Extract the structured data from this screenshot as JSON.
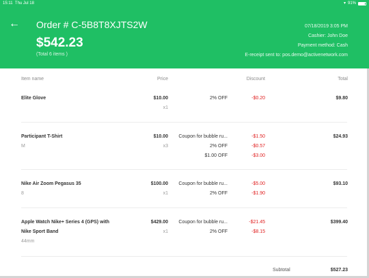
{
  "status_bar": {
    "time": "15:11",
    "date": "Thu Jul 18",
    "battery": "91%",
    "wifi_icon": "wifi-icon",
    "battery_level": 0.91
  },
  "header": {
    "order_title": "Order # C-5B8T8XJTS2W",
    "order_total": "$542.23",
    "item_count": "(Total 6 items )",
    "datetime": "07/18/2019 3:05 PM",
    "cashier": "Cashier: John Doe",
    "payment_method": "Payment method: Cash",
    "ereceipt": "E-receipt sent to: pos.demo@activenetwork.com",
    "back_icon": "arrow-left-icon"
  },
  "columns": {
    "item_name": "Item name",
    "price": "Price",
    "discount": "Discount",
    "total": "Total"
  },
  "items": [
    {
      "name": "Elite Glove",
      "variant": "",
      "price": "$10.00",
      "qty": "x1",
      "discounts": [
        {
          "desc": "2% OFF",
          "amount": "-$0.20"
        }
      ],
      "total": "$9.80"
    },
    {
      "name": "Participant T-Shirt",
      "variant": "M",
      "price": "$10.00",
      "qty": "x3",
      "discounts": [
        {
          "desc": "Coupon for bubble ru...",
          "amount": "-$1.50"
        },
        {
          "desc": "2% OFF",
          "amount": "-$0.57"
        },
        {
          "desc": "$1.00 OFF",
          "amount": "-$3.00"
        }
      ],
      "total": "$24.93"
    },
    {
      "name": "Nike Air Zoom Pegasus 35",
      "variant": "8",
      "price": "$100.00",
      "qty": "x1",
      "discounts": [
        {
          "desc": "Coupon for bubble ru...",
          "amount": "-$5.00"
        },
        {
          "desc": "2% OFF",
          "amount": "-$1.90"
        }
      ],
      "total": "$93.10"
    },
    {
      "name_line1": "Apple Watch Nike+ Series 4 (GPS) with",
      "name_line2": "Nike Sport Band",
      "variant": "44mm",
      "price": "$429.00",
      "qty": "x1",
      "discounts": [
        {
          "desc": "Coupon for bubble ru...",
          "amount": "-$21.45"
        },
        {
          "desc": "2% OFF",
          "amount": "-$8.15"
        }
      ],
      "total": "$399.40"
    }
  ],
  "summary": {
    "subtotal_label": "Subtotal",
    "subtotal_value": "$527.23"
  },
  "colors": {
    "accent": "#1fbf64",
    "negative": "#e02020"
  }
}
